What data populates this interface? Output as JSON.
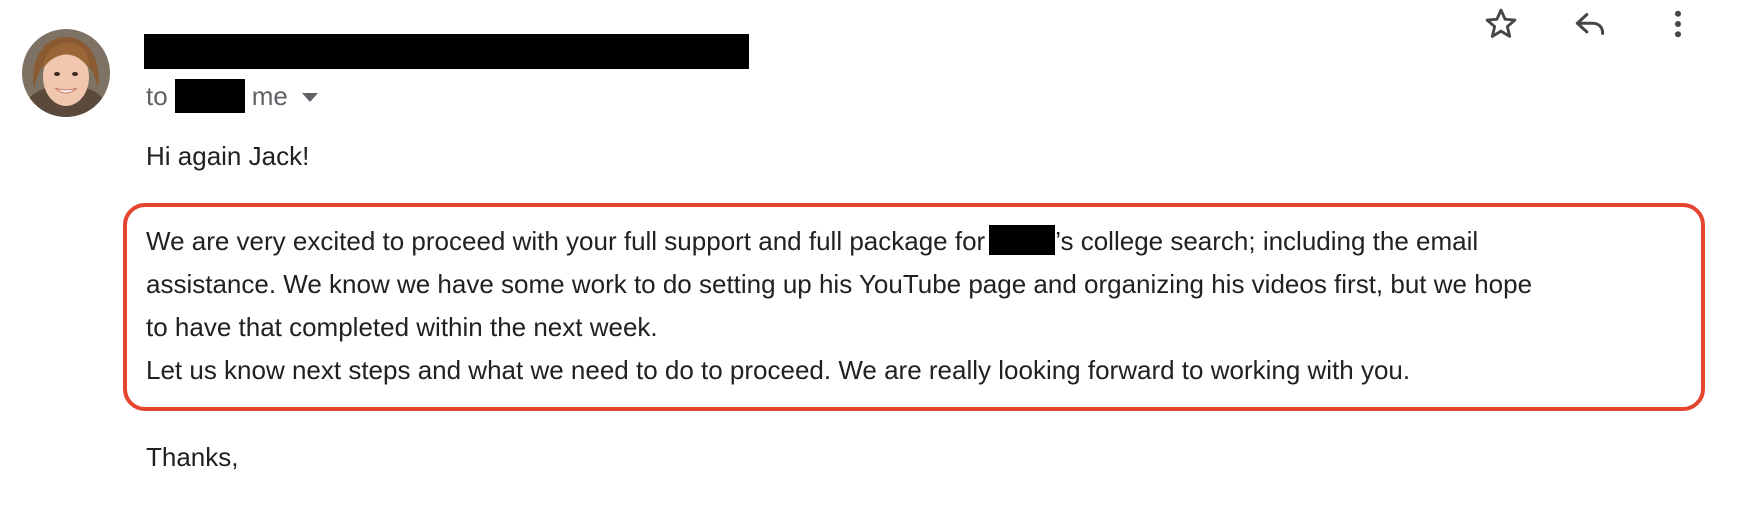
{
  "header": {
    "to_label": "to",
    "to_me": "me",
    "actions": {
      "star_icon": "star-outline-icon",
      "reply_icon": "reply-icon",
      "more_icon": "more-vertical-icon"
    }
  },
  "body": {
    "greeting": "Hi again Jack!",
    "paragraph_1": {
      "line_1_before": "We are very excited to proceed with your full support and full package for",
      "line_1_after": "’s college search; including the email",
      "line_2": "assistance.  We know we have some work to do setting up his YouTube page and organizing his videos first, but we hope",
      "line_3": "to have that completed within the next week."
    },
    "paragraph_2": "Let us know next steps and what we need to do to proceed.  We are really looking forward to working with you.",
    "signoff": "Thanks,"
  },
  "colors": {
    "highlight_border": "#e5452e",
    "text": "#202124",
    "muted_text": "#5f6368",
    "redaction": "#000000"
  }
}
